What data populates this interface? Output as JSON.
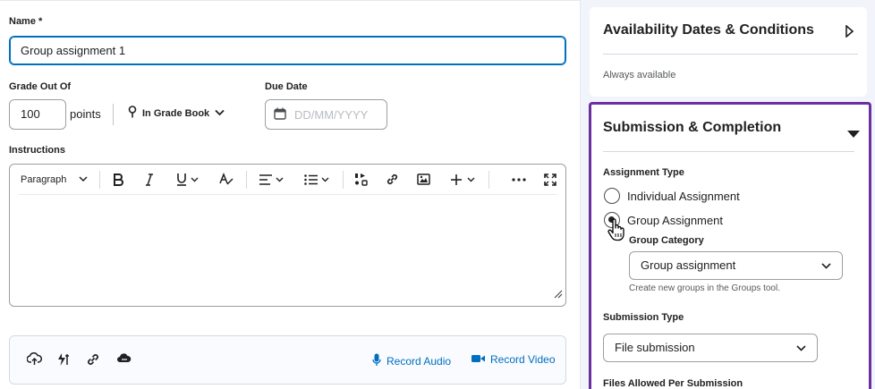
{
  "form": {
    "name_label": "Name *",
    "name_value": "Group assignment 1",
    "grade_label": "Grade Out Of",
    "grade_value": "100",
    "points_label": "points",
    "gradebook_label": "In Grade Book",
    "due_label": "Due Date",
    "due_placeholder": "DD/MM/YYYY",
    "instructions_label": "Instructions",
    "paragraph_label": "Paragraph"
  },
  "attachments": {
    "record_audio": "Record Audio",
    "record_video": "Record Video"
  },
  "availability": {
    "title": "Availability Dates & Conditions",
    "subtitle": "Always available"
  },
  "submission": {
    "title": "Submission & Completion",
    "assignment_type_label": "Assignment Type",
    "options": [
      "Individual Assignment",
      "Group Assignment"
    ],
    "selected_option": "Group Assignment",
    "group_category_label": "Group Category",
    "group_category_value": "Group assignment",
    "group_hint": "Create new groups in the Groups tool.",
    "submission_type_label": "Submission Type",
    "submission_type_value": "File submission",
    "files_allowed_label": "Files Allowed Per Submission"
  },
  "colors": {
    "accent": "#006fbf",
    "focus_outline": "#6b2fa0",
    "panel_bg": "#f1f5fb"
  },
  "icons": [
    "calendar-icon",
    "pin-icon",
    "bold-icon",
    "italic-icon",
    "underline-icon",
    "clear-format-icon",
    "align-icon",
    "list-icon",
    "insert-stuff-icon",
    "link-icon",
    "image-icon",
    "plus-icon",
    "more-icon",
    "fullscreen-icon",
    "upload-icon",
    "tools-icon",
    "cloud-icon",
    "microphone-icon",
    "video-camera-icon",
    "expand-arrow-icon",
    "collapse-arrow-icon",
    "chevron-down-icon",
    "hand-cursor-icon"
  ]
}
